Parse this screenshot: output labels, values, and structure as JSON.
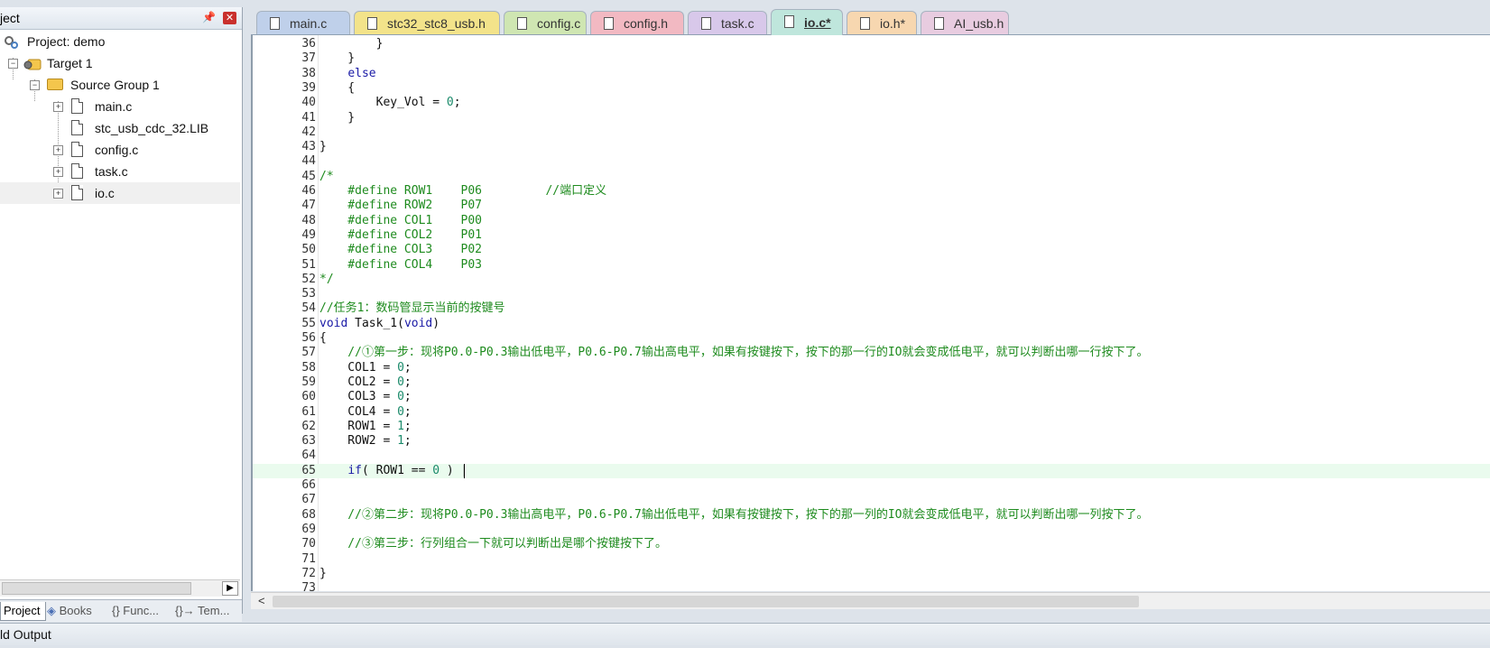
{
  "project_pane": {
    "title": "ject",
    "tree": [
      {
        "label": "Project: demo",
        "type": "project"
      },
      {
        "label": "Target 1",
        "type": "target"
      },
      {
        "label": "Source Group 1",
        "type": "group"
      },
      {
        "label": "main.c",
        "type": "file"
      },
      {
        "label": "stc_usb_cdc_32.LIB",
        "type": "file"
      },
      {
        "label": "config.c",
        "type": "file"
      },
      {
        "label": "task.c",
        "type": "file"
      },
      {
        "label": "io.c",
        "type": "file",
        "selected": true
      }
    ],
    "tabs": [
      "Project",
      "Books",
      "{} Func...",
      "{}→ Tem..."
    ]
  },
  "editor_tabs": [
    {
      "label": "main.c",
      "color": "#bfd0ea"
    },
    {
      "label": "stc32_stc8_usb.h",
      "color": "#f3e38a"
    },
    {
      "label": "config.c",
      "color": "#cfe6b2"
    },
    {
      "label": "config.h",
      "color": "#f2b9c2"
    },
    {
      "label": "task.c",
      "color": "#d8c8ea"
    },
    {
      "label": "io.c*",
      "color": "#bfe6dc",
      "active": true
    },
    {
      "label": "io.h*",
      "color": "#f7d7b0"
    },
    {
      "label": "AI_usb.h",
      "color": "#e8cce0"
    }
  ],
  "code": {
    "current_line": 65,
    "lines": [
      {
        "n": "36",
        "parts": [
          {
            "t": "        }",
            "c": ""
          }
        ]
      },
      {
        "n": "37",
        "parts": [
          {
            "t": "    }",
            "c": ""
          }
        ]
      },
      {
        "n": "38",
        "parts": [
          {
            "t": "    ",
            "c": ""
          },
          {
            "t": "else",
            "c": "kw"
          }
        ]
      },
      {
        "n": "39",
        "parts": [
          {
            "t": "    {",
            "c": ""
          }
        ]
      },
      {
        "n": "40",
        "parts": [
          {
            "t": "        Key_Vol = ",
            "c": ""
          },
          {
            "t": "0",
            "c": "num"
          },
          {
            "t": ";",
            "c": ""
          }
        ]
      },
      {
        "n": "41",
        "parts": [
          {
            "t": "    }",
            "c": ""
          }
        ]
      },
      {
        "n": "42",
        "parts": []
      },
      {
        "n": "43",
        "parts": [
          {
            "t": "}",
            "c": ""
          }
        ]
      },
      {
        "n": "44",
        "parts": []
      },
      {
        "n": "45",
        "parts": [
          {
            "t": "/*",
            "c": "cm"
          }
        ]
      },
      {
        "n": "46",
        "parts": [
          {
            "t": "    #define ROW1    P06         //端口定义",
            "c": "cm"
          }
        ]
      },
      {
        "n": "47",
        "parts": [
          {
            "t": "    #define ROW2    P07",
            "c": "cm"
          }
        ]
      },
      {
        "n": "48",
        "parts": [
          {
            "t": "    #define COL1    P00",
            "c": "cm"
          }
        ]
      },
      {
        "n": "49",
        "parts": [
          {
            "t": "    #define COL2    P01",
            "c": "cm"
          }
        ]
      },
      {
        "n": "50",
        "parts": [
          {
            "t": "    #define COL3    P02",
            "c": "cm"
          }
        ]
      },
      {
        "n": "51",
        "parts": [
          {
            "t": "    #define COL4    P03",
            "c": "cm"
          }
        ]
      },
      {
        "n": "52",
        "parts": [
          {
            "t": "*/",
            "c": "cm"
          }
        ]
      },
      {
        "n": "53",
        "parts": []
      },
      {
        "n": "54",
        "parts": [
          {
            "t": "//任务1：数码管显示当前的按键号",
            "c": "cm"
          }
        ]
      },
      {
        "n": "55",
        "parts": [
          {
            "t": "void",
            "c": "kw"
          },
          {
            "t": " Task_1(",
            "c": ""
          },
          {
            "t": "void",
            "c": "kw"
          },
          {
            "t": ")",
            "c": ""
          }
        ]
      },
      {
        "n": "56",
        "parts": [
          {
            "t": "{",
            "c": ""
          }
        ]
      },
      {
        "n": "57",
        "parts": [
          {
            "t": "    //①第一步：现将P0.0-P0.3输出低电平，P0.6-P0.7输出高电平，如果有按键按下，按下的那一行的IO就会变成低电平，就可以判断出哪一行按下了。",
            "c": "cm"
          }
        ]
      },
      {
        "n": "58",
        "parts": [
          {
            "t": "    COL1 = ",
            "c": ""
          },
          {
            "t": "0",
            "c": "num"
          },
          {
            "t": ";",
            "c": ""
          }
        ]
      },
      {
        "n": "59",
        "parts": [
          {
            "t": "    COL2 = ",
            "c": ""
          },
          {
            "t": "0",
            "c": "num"
          },
          {
            "t": ";",
            "c": ""
          }
        ]
      },
      {
        "n": "60",
        "parts": [
          {
            "t": "    COL3 = ",
            "c": ""
          },
          {
            "t": "0",
            "c": "num"
          },
          {
            "t": ";",
            "c": ""
          }
        ]
      },
      {
        "n": "61",
        "parts": [
          {
            "t": "    COL4 = ",
            "c": ""
          },
          {
            "t": "0",
            "c": "num"
          },
          {
            "t": ";",
            "c": ""
          }
        ]
      },
      {
        "n": "62",
        "parts": [
          {
            "t": "    ROW1 = ",
            "c": ""
          },
          {
            "t": "1",
            "c": "num"
          },
          {
            "t": ";",
            "c": ""
          }
        ]
      },
      {
        "n": "63",
        "parts": [
          {
            "t": "    ROW2 = ",
            "c": ""
          },
          {
            "t": "1",
            "c": "num"
          },
          {
            "t": ";",
            "c": ""
          }
        ]
      },
      {
        "n": "64",
        "parts": []
      },
      {
        "n": "65",
        "parts": [
          {
            "t": "    ",
            "c": ""
          },
          {
            "t": "if",
            "c": "kw"
          },
          {
            "t": "( ROW1 == ",
            "c": ""
          },
          {
            "t": "0",
            "c": "num"
          },
          {
            "t": " ) |",
            "c": ""
          }
        ]
      },
      {
        "n": "66",
        "parts": []
      },
      {
        "n": "67",
        "parts": []
      },
      {
        "n": "68",
        "parts": [
          {
            "t": "    //②第二步：现将P0.0-P0.3输出高电平，P0.6-P0.7输出低电平，如果有按键按下，按下的那一列的IO就会变成低电平，就可以判断出哪一列按下了。",
            "c": "cm"
          }
        ]
      },
      {
        "n": "69",
        "parts": []
      },
      {
        "n": "70",
        "parts": [
          {
            "t": "    //③第三步：行列组合一下就可以判断出是哪个按键按下了。",
            "c": "cm"
          }
        ]
      },
      {
        "n": "71",
        "parts": []
      },
      {
        "n": "72",
        "parts": [
          {
            "t": "}",
            "c": ""
          }
        ]
      },
      {
        "n": "73",
        "parts": []
      }
    ]
  },
  "output": {
    "title": "ld Output"
  }
}
